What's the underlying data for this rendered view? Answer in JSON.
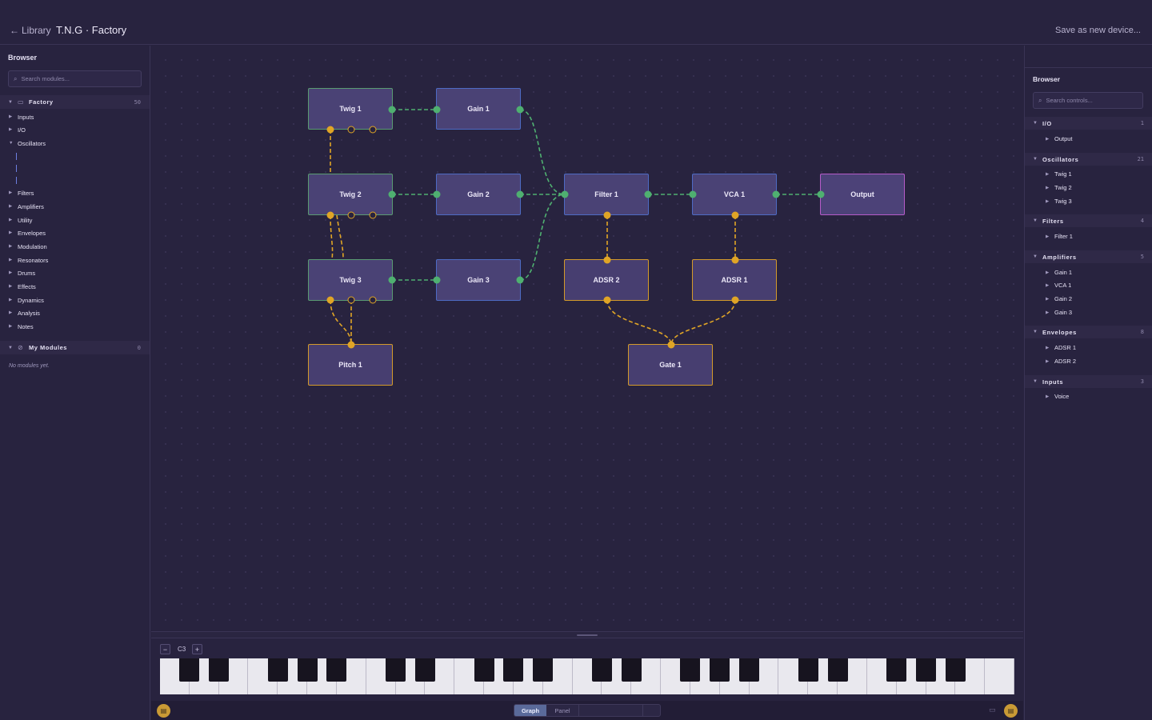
{
  "header": {
    "back_label": "Library",
    "title": "T.N.G · Factory",
    "save_label": "Save as new device..."
  },
  "left_sidebar": {
    "title": "Browser",
    "search_placeholder": "Search modules...",
    "factory": {
      "label": "Factory",
      "count": "50"
    },
    "categories": [
      "Inputs",
      "I/O",
      "Oscillators",
      "Filters",
      "Amplifiers",
      "Utility",
      "Envelopes",
      "Modulation",
      "Resonators",
      "Drums",
      "Effects",
      "Dynamics",
      "Analysis",
      "Notes"
    ],
    "my_modules": {
      "label": "My Modules",
      "count": "0"
    },
    "empty_note": "No modules yet."
  },
  "graph": {
    "nodes": [
      {
        "id": "twig1",
        "label": "Twig 1"
      },
      {
        "id": "gain1",
        "label": "Gain 1"
      },
      {
        "id": "twig2",
        "label": "Twig 2"
      },
      {
        "id": "gain2",
        "label": "Gain 2"
      },
      {
        "id": "filter1",
        "label": "Filter 1"
      },
      {
        "id": "vca1",
        "label": "VCA 1"
      },
      {
        "id": "output",
        "label": "Output"
      },
      {
        "id": "twig3",
        "label": "Twig 3"
      },
      {
        "id": "gain3",
        "label": "Gain 3"
      },
      {
        "id": "adsr2",
        "label": "ADSR 2"
      },
      {
        "id": "adsr1",
        "label": "ADSR 1"
      },
      {
        "id": "pitch1",
        "label": "Pitch 1"
      },
      {
        "id": "gate1",
        "label": "Gate 1"
      }
    ],
    "colors": {
      "audio_wire": "#4fb070",
      "mod_wire": "#e0a526",
      "node_bg": "#4a4275",
      "output_border": "#b65bc8"
    }
  },
  "keyboard": {
    "octave_down": "−",
    "octave_label": "C3",
    "octave_up": "+"
  },
  "bottom_bar": {
    "tabs": [
      {
        "label": "Graph",
        "active": true
      },
      {
        "label": "Panel",
        "active": false
      }
    ]
  },
  "right_sidebar": {
    "title": "Browser",
    "search_placeholder": "Search controls...",
    "groups": [
      {
        "label": "I/O",
        "count": "1",
        "items": [
          "Output"
        ]
      },
      {
        "label": "Oscillators",
        "count": "21",
        "items": [
          "Twig 1",
          "Twig 2",
          "Twig 3"
        ]
      },
      {
        "label": "Filters",
        "count": "4",
        "items": [
          "Filter 1"
        ]
      },
      {
        "label": "Amplifiers",
        "count": "5",
        "items": [
          "Gain 1",
          "VCA 1",
          "Gain 2",
          "Gain 3"
        ]
      },
      {
        "label": "Envelopes",
        "count": "8",
        "items": [
          "ADSR 1",
          "ADSR 2"
        ]
      },
      {
        "label": "Inputs",
        "count": "3",
        "items": [
          "Voice"
        ]
      }
    ]
  }
}
